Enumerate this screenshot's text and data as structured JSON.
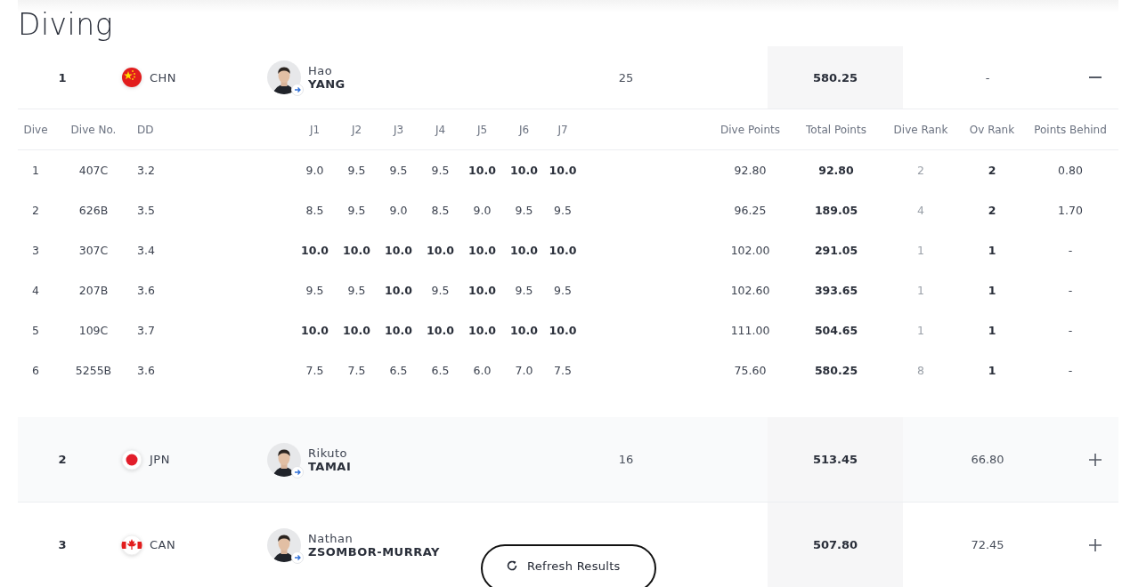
{
  "title": "Diving",
  "athletes": [
    {
      "rank": "1",
      "country": {
        "code": "CHN",
        "kind": "china"
      },
      "first_name": "Hao",
      "last_name": "YANG",
      "dives": "25",
      "total": "580.25",
      "behind": "-",
      "expanded": true,
      "details": {
        "columns": [
          "Dive",
          "Dive No.",
          "DD",
          "J1",
          "J2",
          "J3",
          "J4",
          "J5",
          "J6",
          "J7",
          "Dive Points",
          "Total Points",
          "Dive Rank",
          "Ov Rank",
          "Points Behind"
        ],
        "rows": [
          {
            "dive": "1",
            "dive_no": "407C",
            "dd": "3.2",
            "scores": [
              {
                "value": "9.0",
                "bold": false
              },
              {
                "value": "9.5",
                "bold": false
              },
              {
                "value": "9.5",
                "bold": false
              },
              {
                "value": "9.5",
                "bold": false
              },
              {
                "value": "10.0",
                "bold": true
              },
              {
                "value": "10.0",
                "bold": true
              },
              {
                "value": "10.0",
                "bold": true
              }
            ],
            "dive_points": "92.80",
            "total_points": "92.80",
            "dive_rank": "2",
            "ov_rank": "2",
            "points_behind": "0.80"
          },
          {
            "dive": "2",
            "dive_no": "626B",
            "dd": "3.5",
            "scores": [
              {
                "value": "8.5",
                "bold": false
              },
              {
                "value": "9.5",
                "bold": false
              },
              {
                "value": "9.0",
                "bold": false
              },
              {
                "value": "8.5",
                "bold": false
              },
              {
                "value": "9.0",
                "bold": false
              },
              {
                "value": "9.5",
                "bold": false
              },
              {
                "value": "9.5",
                "bold": false
              }
            ],
            "dive_points": "96.25",
            "total_points": "189.05",
            "dive_rank": "4",
            "ov_rank": "2",
            "points_behind": "1.70"
          },
          {
            "dive": "3",
            "dive_no": "307C",
            "dd": "3.4",
            "scores": [
              {
                "value": "10.0",
                "bold": true
              },
              {
                "value": "10.0",
                "bold": true
              },
              {
                "value": "10.0",
                "bold": true
              },
              {
                "value": "10.0",
                "bold": true
              },
              {
                "value": "10.0",
                "bold": true
              },
              {
                "value": "10.0",
                "bold": true
              },
              {
                "value": "10.0",
                "bold": true
              }
            ],
            "dive_points": "102.00",
            "total_points": "291.05",
            "dive_rank": "1",
            "ov_rank": "1",
            "points_behind": "-"
          },
          {
            "dive": "4",
            "dive_no": "207B",
            "dd": "3.6",
            "scores": [
              {
                "value": "9.5",
                "bold": false
              },
              {
                "value": "9.5",
                "bold": false
              },
              {
                "value": "10.0",
                "bold": true
              },
              {
                "value": "9.5",
                "bold": false
              },
              {
                "value": "10.0",
                "bold": true
              },
              {
                "value": "9.5",
                "bold": false
              },
              {
                "value": "9.5",
                "bold": false
              }
            ],
            "dive_points": "102.60",
            "total_points": "393.65",
            "dive_rank": "1",
            "ov_rank": "1",
            "points_behind": "-"
          },
          {
            "dive": "5",
            "dive_no": "109C",
            "dd": "3.7",
            "scores": [
              {
                "value": "10.0",
                "bold": true
              },
              {
                "value": "10.0",
                "bold": true
              },
              {
                "value": "10.0",
                "bold": true
              },
              {
                "value": "10.0",
                "bold": true
              },
              {
                "value": "10.0",
                "bold": true
              },
              {
                "value": "10.0",
                "bold": true
              },
              {
                "value": "10.0",
                "bold": true
              }
            ],
            "dive_points": "111.00",
            "total_points": "504.65",
            "dive_rank": "1",
            "ov_rank": "1",
            "points_behind": "-"
          },
          {
            "dive": "6",
            "dive_no": "5255B",
            "dd": "3.6",
            "scores": [
              {
                "value": "7.5",
                "bold": false
              },
              {
                "value": "7.5",
                "bold": false
              },
              {
                "value": "6.5",
                "bold": false
              },
              {
                "value": "6.5",
                "bold": false
              },
              {
                "value": "6.0",
                "bold": false
              },
              {
                "value": "7.0",
                "bold": false
              },
              {
                "value": "7.5",
                "bold": false
              }
            ],
            "dive_points": "75.60",
            "total_points": "580.25",
            "dive_rank": "8",
            "ov_rank": "1",
            "points_behind": "-"
          }
        ]
      }
    },
    {
      "rank": "2",
      "country": {
        "code": "JPN",
        "kind": "japan"
      },
      "first_name": "Rikuto",
      "last_name": "TAMAI",
      "dives": "16",
      "total": "513.45",
      "behind": "66.80",
      "expanded": false
    },
    {
      "rank": "3",
      "country": {
        "code": "CAN",
        "kind": "canada"
      },
      "first_name": "Nathan",
      "last_name": "ZSOMBOR-MURRAY",
      "total": "507.80",
      "behind": "72.45",
      "expanded": false
    }
  ],
  "refresh_button": {
    "label": "Refresh Results"
  }
}
